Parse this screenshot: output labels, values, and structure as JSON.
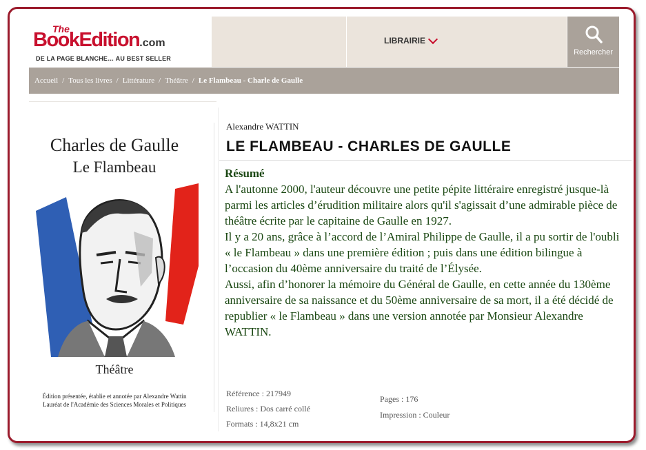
{
  "header": {
    "logo_the": "The",
    "logo_brand": "BookEdition",
    "logo_com": ".com",
    "logo_tagline": "DE LA PAGE BLANCHE… AU BEST SELLER",
    "nav_librairie": "LIBRAIRIE",
    "search_label": "Rechercher"
  },
  "breadcrumb": {
    "items": [
      "Accueil",
      "Tous les livres",
      "Littérature",
      "Théâtre"
    ],
    "current": "Le Flambeau - Charle de Gaulle"
  },
  "cover": {
    "title_line1": "Charles de Gaulle",
    "title_line2": "Le Flambeau",
    "genre": "Théâtre",
    "credit_line1": "Édition présentée, établie et annotée par Alexandre Wattin",
    "credit_line2": "Lauréat de l'Académie des Sciences Morales et Politiques"
  },
  "book": {
    "author": "Alexandre WATTIN",
    "title": "LE FLAMBEAU - CHARLES DE GAULLE",
    "resume_heading": "Résumé",
    "resume_paragraphs": [
      "A l'autonne 2000, l'auteur découvre une petite pépite littéraire enregistré jusque-là parmi les articles d’érudition militaire alors qu'il s'agissait d’une admirable pièce de théâtre écrite par le capitaine de Gaulle en 1927.",
      "Il y a 20 ans, grâce à l’accord de l’Amiral Philippe de Gaulle, il a pu sortir de l'oubli « le Flambeau » dans une première édition ; puis dans une édition bilingue à l’occasion du 40ème anniversaire du traité de l’Élysée.",
      "Aussi, afin d’honorer la mémoire du Général de Gaulle, en cette année du 130ème anniversaire de sa naissance et du 50ème anniversaire de sa mort, il a été décidé de republier « le Flambeau » dans une version annotée par Monsieur Alexandre WATTIN."
    ],
    "reference": "Référence : 217949",
    "reliures": "Reliures : Dos carré collé",
    "formats": "Formats : 14,8x21 cm",
    "pages": "Pages : 176",
    "impression": "Impression : Couleur"
  },
  "colors": {
    "brand_red": "#c8102e",
    "frame_border": "#9b1b2c",
    "resume_green": "#1a4712",
    "nav_bg": "#ebe4dc",
    "breadcrumb_bg": "#aaa29a",
    "flag_blue": "#2f5fb4",
    "flag_red": "#e2231a"
  },
  "icons": {
    "search": "search-icon",
    "dropdown": "chevron-down-icon"
  }
}
